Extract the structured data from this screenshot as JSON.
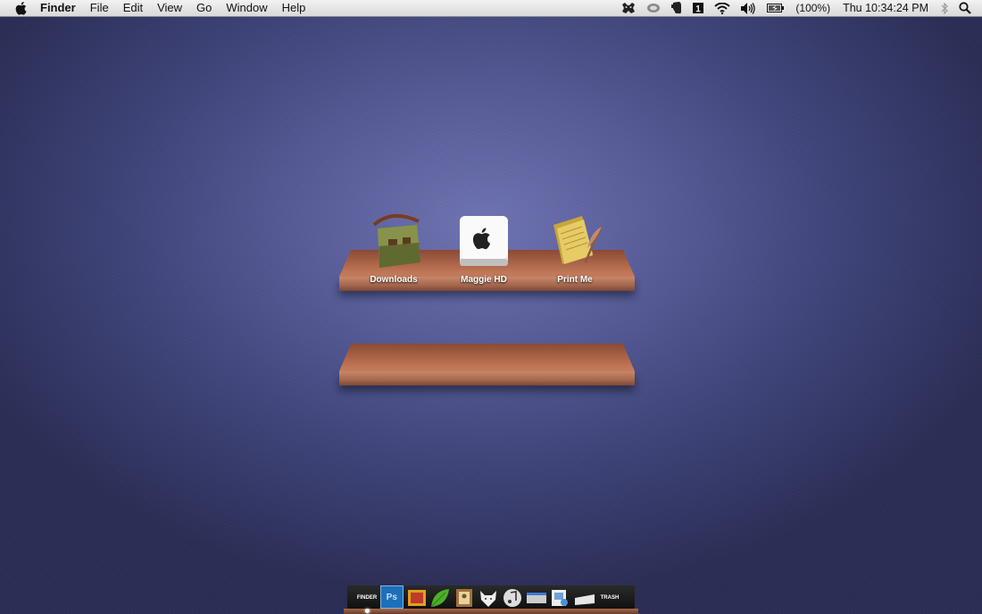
{
  "menubar": {
    "app_name": "Finder",
    "menus": [
      "File",
      "Edit",
      "View",
      "Go",
      "Window",
      "Help"
    ],
    "battery_text": "(100%)",
    "clock": "Thu 10:34:24 PM",
    "status_icons": [
      "growl-icon",
      "sync-icon",
      "evernote-icon",
      "1password-icon",
      "wifi-icon",
      "volume-icon",
      "battery-icon",
      "bluetooth-icon",
      "spotlight-icon"
    ]
  },
  "desktop": {
    "shelf1_items": [
      {
        "label": "Downloads",
        "icon": "satchel-icon"
      },
      {
        "label": "Maggie HD",
        "icon": "hard-drive-icon"
      },
      {
        "label": "Print Me",
        "icon": "papers-quill-icon"
      }
    ]
  },
  "dock": {
    "items": [
      {
        "name": "finder",
        "label": "FINDER"
      },
      {
        "name": "photoshop",
        "label": "Ps"
      },
      {
        "name": "mail-stamp",
        "label": ""
      },
      {
        "name": "leaf",
        "label": ""
      },
      {
        "name": "address-book",
        "label": ""
      },
      {
        "name": "fox",
        "label": ""
      },
      {
        "name": "itunes",
        "label": ""
      },
      {
        "name": "scanner",
        "label": ""
      },
      {
        "name": "preview",
        "label": ""
      },
      {
        "name": "drive",
        "label": ""
      },
      {
        "name": "trash",
        "label": "TRASH"
      }
    ]
  },
  "colors": {
    "wallpaper": "#5a5f9c",
    "shelf": "#b06a4c"
  }
}
